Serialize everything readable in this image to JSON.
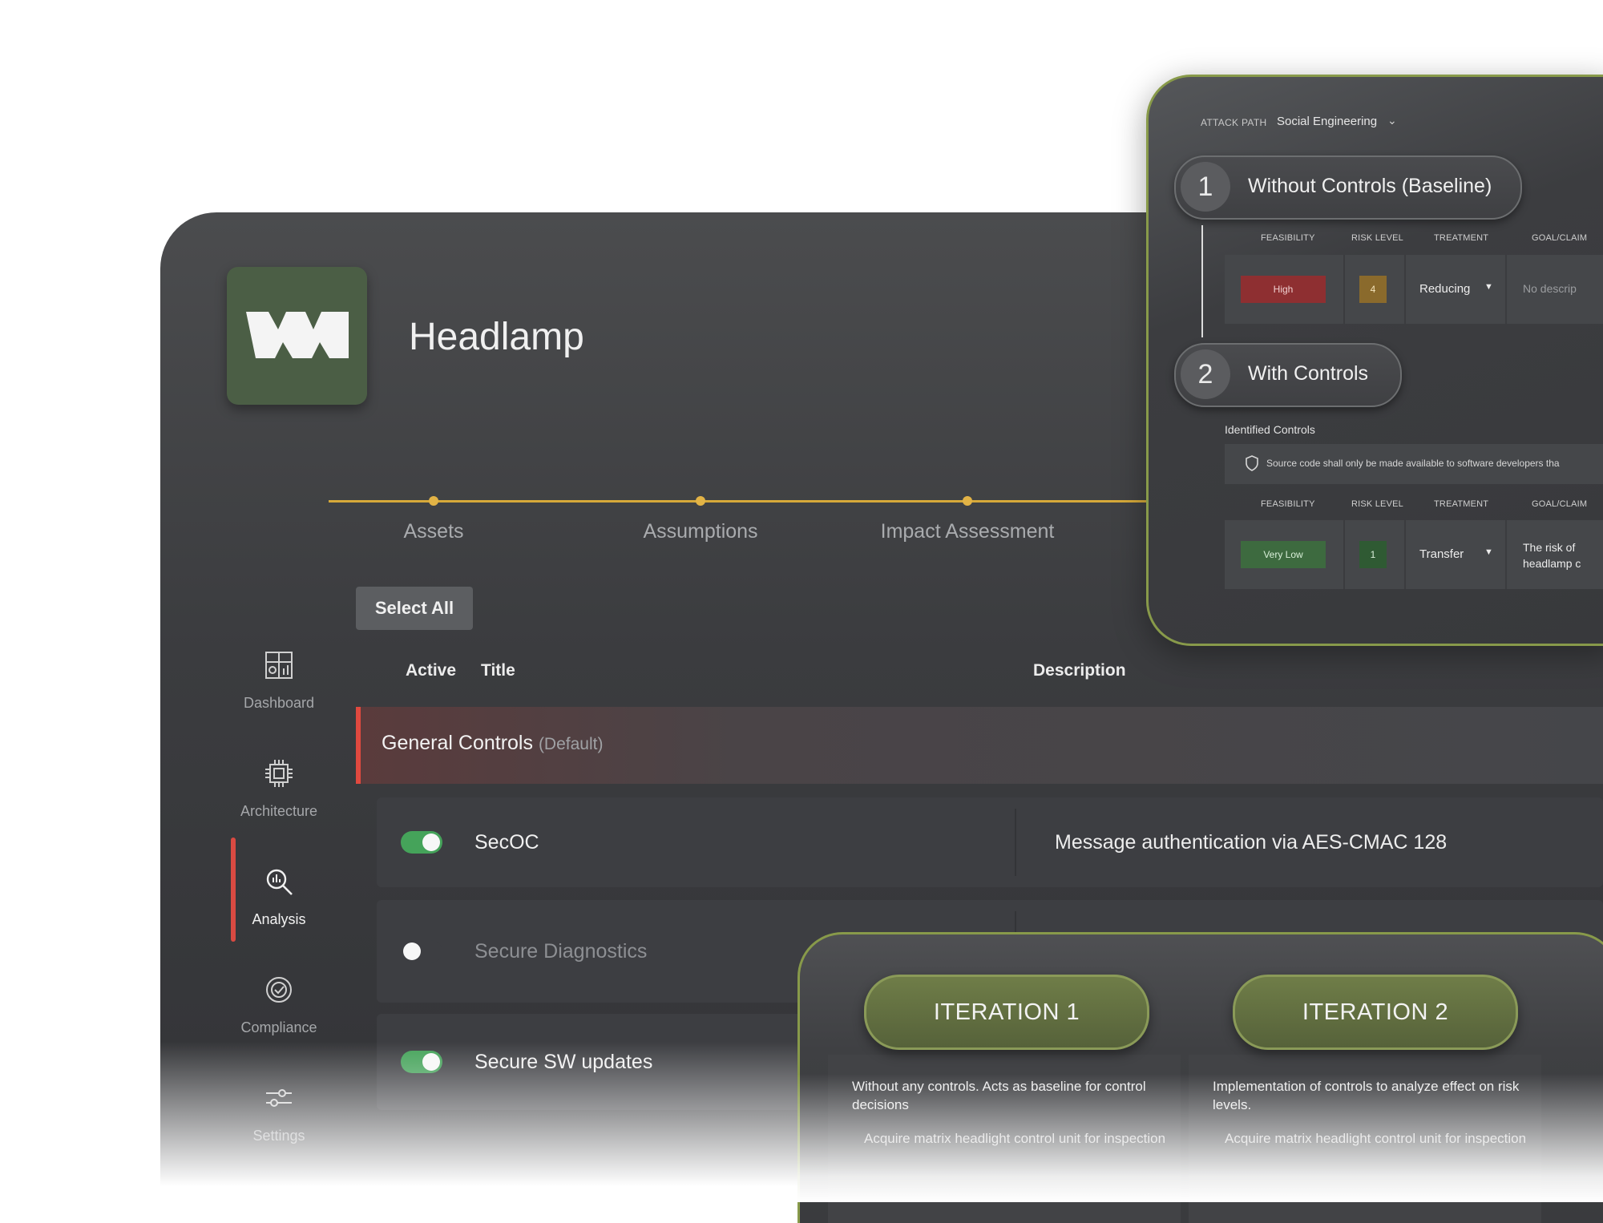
{
  "project": {
    "title": "Headlamp"
  },
  "stepper": {
    "steps": [
      "Assets",
      "Assumptions",
      "Impact Assessment"
    ]
  },
  "sidebar": {
    "items": [
      {
        "label": "Dashboard",
        "icon": "dashboard-icon"
      },
      {
        "label": "Architecture",
        "icon": "chip-icon"
      },
      {
        "label": "Analysis",
        "icon": "analysis-search-icon",
        "active": true
      },
      {
        "label": "Compliance",
        "icon": "compliance-icon"
      },
      {
        "label": "Settings",
        "icon": "sliders-icon"
      }
    ]
  },
  "controls_table": {
    "select_all_label": "Select All",
    "columns": {
      "active": "Active",
      "title": "Title",
      "description": "Description"
    },
    "group": {
      "name": "General Controls",
      "tag": "(Default)"
    },
    "rows": [
      {
        "active": true,
        "title": "SecOC",
        "description": "Message authentication via AES-CMAC 128"
      },
      {
        "active": false,
        "title": "Secure Diagnostics",
        "description": ""
      },
      {
        "active": true,
        "title": "Secure SW updates",
        "description": ""
      }
    ]
  },
  "attack_panel": {
    "attack_path_label": "ATTACK PATH",
    "attack_path_value": "Social Engineering",
    "sections": [
      {
        "number": "1",
        "title": "Without Controls (Baseline)",
        "columns": [
          "FEASIBILITY",
          "RISK LEVEL",
          "TREATMENT",
          "GOAL/CLAIM"
        ],
        "feasibility": "High",
        "risk_level": "4",
        "treatment": "Reducing",
        "goal_claim": "No descrip"
      },
      {
        "number": "2",
        "title": "With Controls",
        "identified_controls_label": "Identified Controls",
        "control_text": "Source code shall only be made available to software developers tha",
        "columns": [
          "FEASIBILITY",
          "RISK LEVEL",
          "TREATMENT",
          "GOAL/CLAIM"
        ],
        "feasibility": "Very Low",
        "risk_level": "1",
        "treatment": "Transfer",
        "goal_claim_line1": "The risk of",
        "goal_claim_line2": "headlamp c"
      }
    ],
    "colors": {
      "high": "#8e2f31",
      "risk_4": "#8a6a2c",
      "very_low": "#3d6a3f",
      "risk_1": "#2f5a33"
    }
  },
  "iterations": [
    {
      "label": "ITERATION 1",
      "description": "Without any controls. Acts as baseline for control decisions",
      "sub": "Acquire matrix headlight control unit for inspection"
    },
    {
      "label": "ITERATION 2",
      "description": "Implementation of controls to analyze effect on risk levels.",
      "sub": "Acquire matrix headlight control unit for inspection"
    }
  ],
  "theme": {
    "accent_green": "#889a4a",
    "accent_red": "#e0493f",
    "step_gold": "#d6a93a",
    "toggle_on": "#45a35a"
  }
}
